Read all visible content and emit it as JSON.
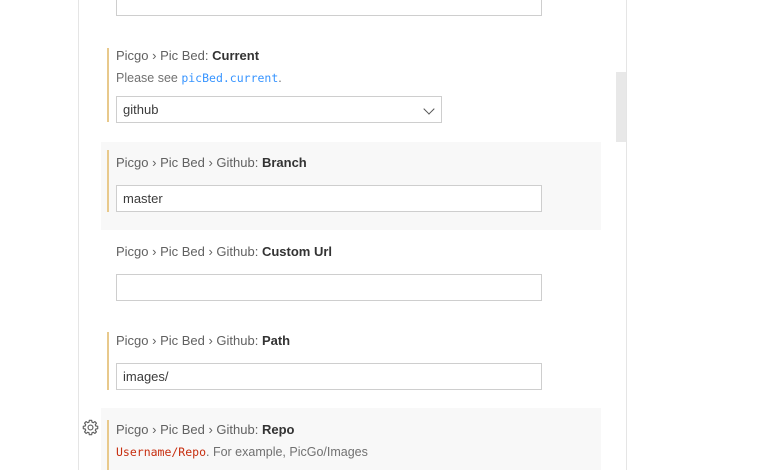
{
  "settings": {
    "current": {
      "prefix": "Picgo › Pic Bed: ",
      "name": "Current",
      "desc_before": "Please see ",
      "desc_code": "picBed.current",
      "desc_after": ".",
      "value": "github"
    },
    "branch": {
      "prefix": "Picgo › Pic Bed › Github: ",
      "name": "Branch",
      "value": "master"
    },
    "custom_url": {
      "prefix": "Picgo › Pic Bed › Github: ",
      "name": "Custom Url",
      "value": ""
    },
    "path": {
      "prefix": "Picgo › Pic Bed › Github: ",
      "name": "Path",
      "value": "images/"
    },
    "repo": {
      "prefix": "Picgo › Pic Bed › Github: ",
      "name": "Repo",
      "desc_code": "Username/Repo",
      "desc_after": ". For example, PicGo/Images"
    }
  },
  "icons": {
    "gear": "gear-icon",
    "chevron": "chevron-down-icon"
  },
  "colors": {
    "modified_indicator": "#e8c98c",
    "link": "#3794ff",
    "error_code": "#c72e0f"
  }
}
